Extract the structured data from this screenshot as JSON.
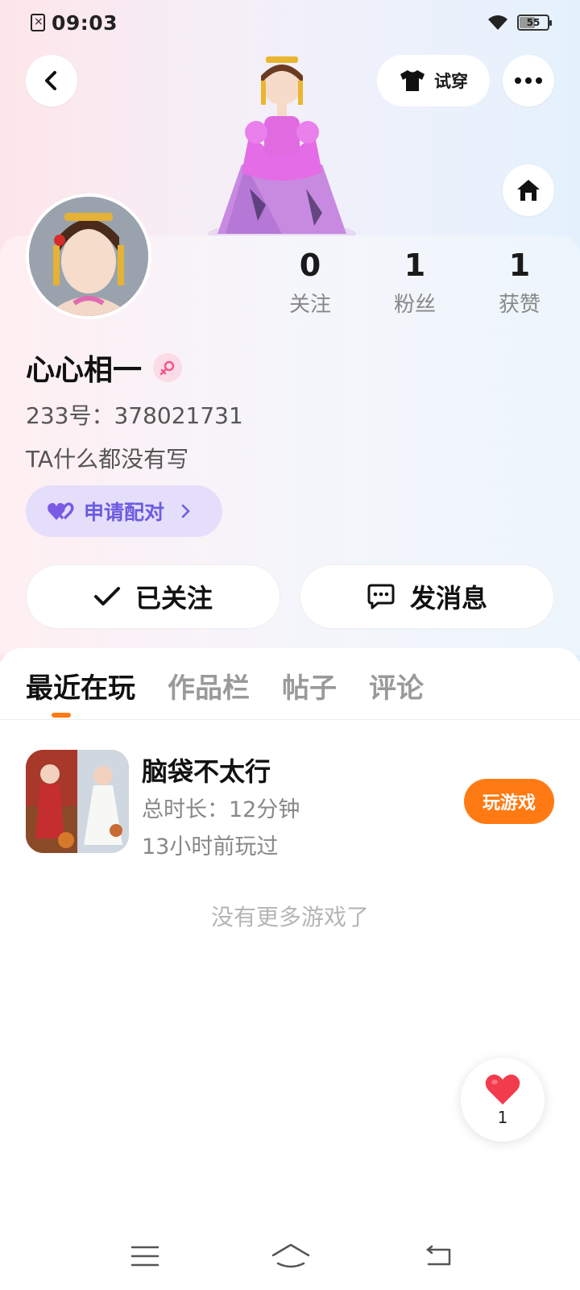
{
  "status_bar": {
    "time": "09:03",
    "battery_level": "55",
    "battery_fraction": 0.55
  },
  "header": {
    "tryon_label": "试穿"
  },
  "profile": {
    "stats": [
      {
        "value": "0",
        "label": "关注"
      },
      {
        "value": "1",
        "label": "粉丝"
      },
      {
        "value": "1",
        "label": "获赞"
      }
    ],
    "username": "心心相一",
    "uid_label": "233号：",
    "uid_value": "378021731",
    "bio": "TA什么都没有写",
    "pair_button_label": "申请配对",
    "follow_button_label": "已关注",
    "message_button_label": "发消息"
  },
  "tabs": [
    {
      "label": "最近在玩",
      "active": true
    },
    {
      "label": "作品栏",
      "active": false
    },
    {
      "label": "帖子",
      "active": false
    },
    {
      "label": "评论",
      "active": false
    }
  ],
  "recent_games": [
    {
      "title": "脑袋不太行",
      "duration": "总时长：12分钟",
      "last_played": "13小时前玩过",
      "play_button_label": "玩游戏"
    }
  ],
  "no_more_text": "没有更多游戏了",
  "like_fab": {
    "count": "1"
  },
  "colors": {
    "accent_orange": "#ff7a12",
    "pair_purple": "#6b5ce0",
    "like_red": "#f23b4c"
  }
}
